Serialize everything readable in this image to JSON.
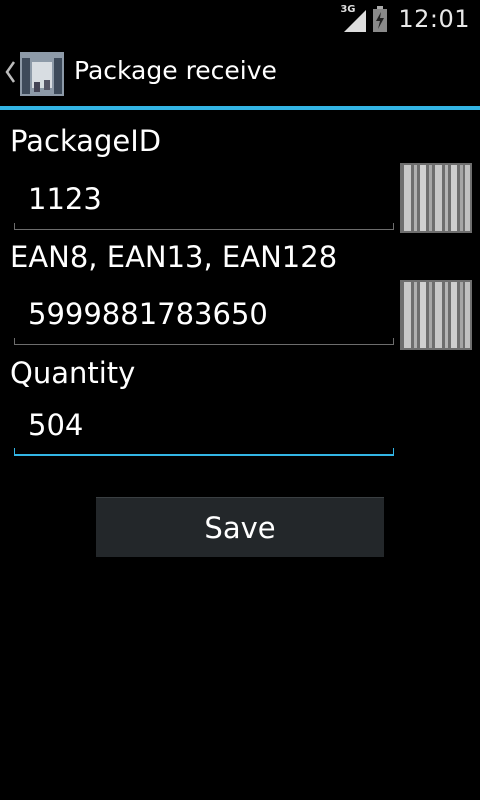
{
  "status_bar": {
    "network_type": "3G",
    "time": "12:01",
    "signal_icon": "signal-icon",
    "battery_icon": "battery-charging-icon"
  },
  "action_bar": {
    "title": "Package receive",
    "up_icon": "up-caret-icon",
    "app_icon": "warehouse-icon",
    "accent_color": "#33b5e5"
  },
  "form": {
    "package_id": {
      "label": "PackageID",
      "value": "1123",
      "scan_icon": "barcode-icon"
    },
    "ean": {
      "label": "EAN8, EAN13, EAN128",
      "value": "5999881783650",
      "scan_icon": "barcode-icon"
    },
    "quantity": {
      "label": "Quantity",
      "value": "504"
    },
    "save_label": "Save"
  }
}
